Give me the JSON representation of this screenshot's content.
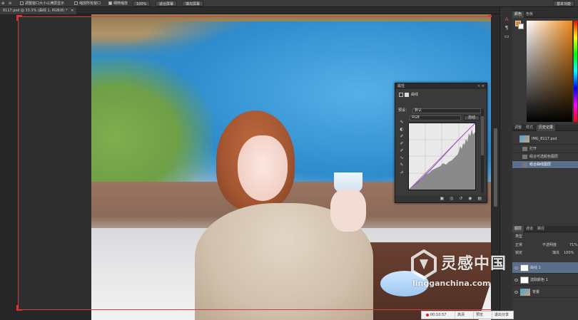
{
  "options_bar": {
    "resize_windows": "调整窗口大小以满屏显示",
    "zoom_all": "缩放所有窗口",
    "scrubby_zoom": "细微缩放",
    "zoom_100": "100%",
    "fit_screen": "适合屏幕",
    "fill_screen": "填充屏幕",
    "workspace": "基本功能"
  },
  "document_tab": {
    "label": "8117.psd @ 33.3% (曲线 1, RGB/8) *",
    "close": "×"
  },
  "tools": [
    "A",
    "¶",
    "▭"
  ],
  "color_panel": {
    "tabs": [
      "颜色",
      "色板"
    ],
    "foreground": "#e8821a",
    "background": "#ffffff"
  },
  "history_panel": {
    "tabs": [
      "调整",
      "样式",
      "历史记录"
    ],
    "snapshot": "IMG_8117.psd",
    "items": [
      "打开",
      "组合可选颜色图层",
      "组合曲线图层"
    ]
  },
  "layers_panel": {
    "tabs": [
      "图层",
      "通道",
      "路径"
    ],
    "kind": "类型",
    "blend_mode": "正常",
    "opacity_label": "不透明度",
    "opacity_value": "71%",
    "fill_label": "填充",
    "fill_value": "100%",
    "lock_label": "锁定",
    "layers": [
      "曲线 1",
      "选取颜色 1",
      "背景"
    ]
  },
  "properties_panel": {
    "title": "属性",
    "close": "× ≡",
    "subtitle": "曲线",
    "preset_label": "预设：",
    "preset_value": "默认",
    "channel_value": "RGB",
    "auto_label": "自动",
    "tool_glyphs": [
      "✎",
      "◐",
      "✐",
      "✐",
      "✐",
      "∿",
      "✎",
      "⊿"
    ],
    "bottom_glyphs": "▣ ◎ ↺ ◉ ▤"
  },
  "recorder": {
    "time": "00:10:57",
    "buttons": [
      "高清",
      "预览",
      "退出分享"
    ]
  },
  "watermark": {
    "cn": "灵感中国",
    "en": "lingganchina.com"
  }
}
